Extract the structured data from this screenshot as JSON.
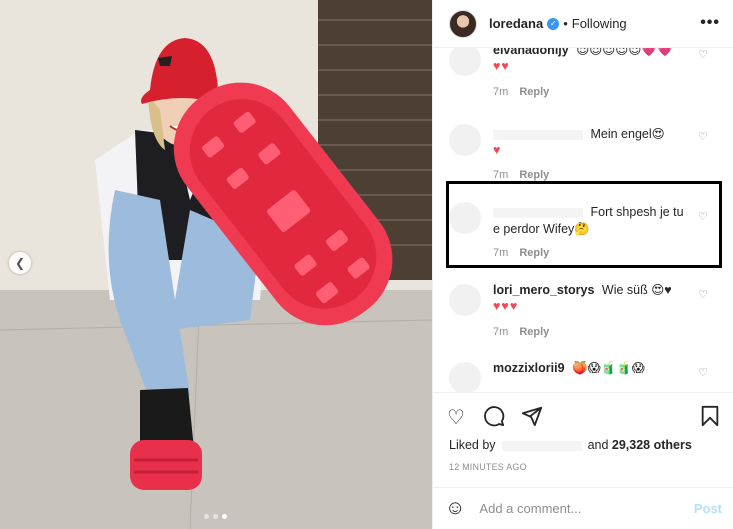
{
  "header": {
    "username": "loredana",
    "verified_icon": "verified-badge-icon",
    "separator": "•",
    "follow_status": "Following",
    "more_icon": "more-options-icon"
  },
  "comments": [
    {
      "user": "",
      "text": "",
      "partial": "elvanadonijy",
      "emoji": "😉😉😉😉😉💗💗",
      "hearts": "♥♥",
      "time": "7m",
      "reply": "Reply"
    },
    {
      "user": "",
      "text": "Mein engel😍",
      "hearts": "♥",
      "time": "7m",
      "reply": "Reply"
    },
    {
      "user": "",
      "text": "Fort shpesh je tu e perdor Wifey🤔",
      "time": "7m",
      "reply": "Reply"
    },
    {
      "user": "lori_mero_storys",
      "text": "Wie süß 😍♥",
      "hearts": "♥♥♥",
      "time": "7m",
      "reply": "Reply"
    },
    {
      "user": "mozzixlorii9",
      "text": "🍑😱🧃🧃😱",
      "time": "",
      "reply": ""
    }
  ],
  "actions": {
    "like_icon": "heart-outline-icon",
    "comment_icon": "comment-icon",
    "share_icon": "share-icon",
    "save_icon": "bookmark-icon"
  },
  "likes": {
    "prefix": "Liked by",
    "suffix": "and",
    "count": "29,328 others"
  },
  "timestamp": "12 MINUTES AGO",
  "add_comment": {
    "placeholder": "Add a comment...",
    "post_label": "Post",
    "emoji_icon": "emoji-smile-icon"
  },
  "photo": {
    "prev_icon": "chevron-left-icon",
    "carousel_pages": 3,
    "carousel_active": 3
  }
}
